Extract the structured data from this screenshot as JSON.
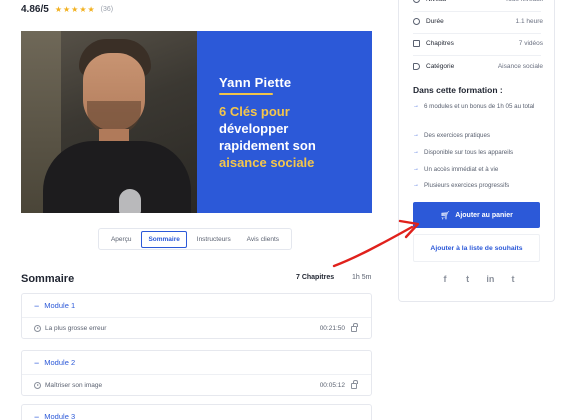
{
  "rating": {
    "score": "4.86",
    "suffix": "/5",
    "stars": 5,
    "count": "(36)"
  },
  "hero": {
    "author": "Yann Piette",
    "title_lines": [
      {
        "text": "6 Clés pour",
        "color": "#f4c64a"
      },
      {
        "text": "développer",
        "color": "#ffffff"
      },
      {
        "text": "rapidement son",
        "color": "#ffffff"
      },
      {
        "text": "aisance sociale",
        "color": "#f4c64a"
      }
    ],
    "panel_color": "#2c59d8"
  },
  "tabs": [
    {
      "label": "Aperçu",
      "active": false
    },
    {
      "label": "Sommaire",
      "active": true
    },
    {
      "label": "Instructeurs",
      "active": false
    },
    {
      "label": "Avis clients",
      "active": false
    }
  ],
  "sommaire": {
    "title": "Sommaire",
    "chapters": "7 Chapitres",
    "duration": "1h 5m"
  },
  "modules": [
    {
      "name": "Module 1",
      "lessons": [
        {
          "title": "La plus grosse erreur",
          "time": "00:21:50"
        }
      ]
    },
    {
      "name": "Module 2",
      "lessons": [
        {
          "title": "Maîtriser son image",
          "time": "00:05:12"
        }
      ]
    },
    {
      "name": "Module 3",
      "lessons": []
    }
  ],
  "sidebar": {
    "info": [
      {
        "icon": "level-icon",
        "label": "Niveau",
        "value": "Tous niveaux"
      },
      {
        "icon": "clock-icon",
        "label": "Durée",
        "value": "1.1 heure"
      },
      {
        "icon": "chapters-icon",
        "label": "Chapitres",
        "value": "7 vidéos"
      },
      {
        "icon": "tag-icon",
        "label": "Catégorie",
        "value": "Aisance sociale"
      }
    ],
    "includes_title": "Dans cette formation :",
    "features": [
      "6 modules et un bonus de 1h 05 au total",
      "Des exercices pratiques",
      "Disponible sur tous les appareils",
      "Un accès immédiat et à vie",
      "Plusieurs exercices progressifs"
    ],
    "cart_label": "Ajouter au panier",
    "wishlist_label": "Ajouter à la liste de souhaits",
    "socials": [
      {
        "icon": "facebook-icon",
        "glyph": "f"
      },
      {
        "icon": "twitter-icon",
        "glyph": "t"
      },
      {
        "icon": "linkedin-icon",
        "glyph": "in"
      },
      {
        "icon": "tumblr-icon",
        "glyph": "t"
      }
    ]
  },
  "colors": {
    "accent": "#2c59d8",
    "star": "#f2b01e",
    "annotation": "#e0211c"
  }
}
